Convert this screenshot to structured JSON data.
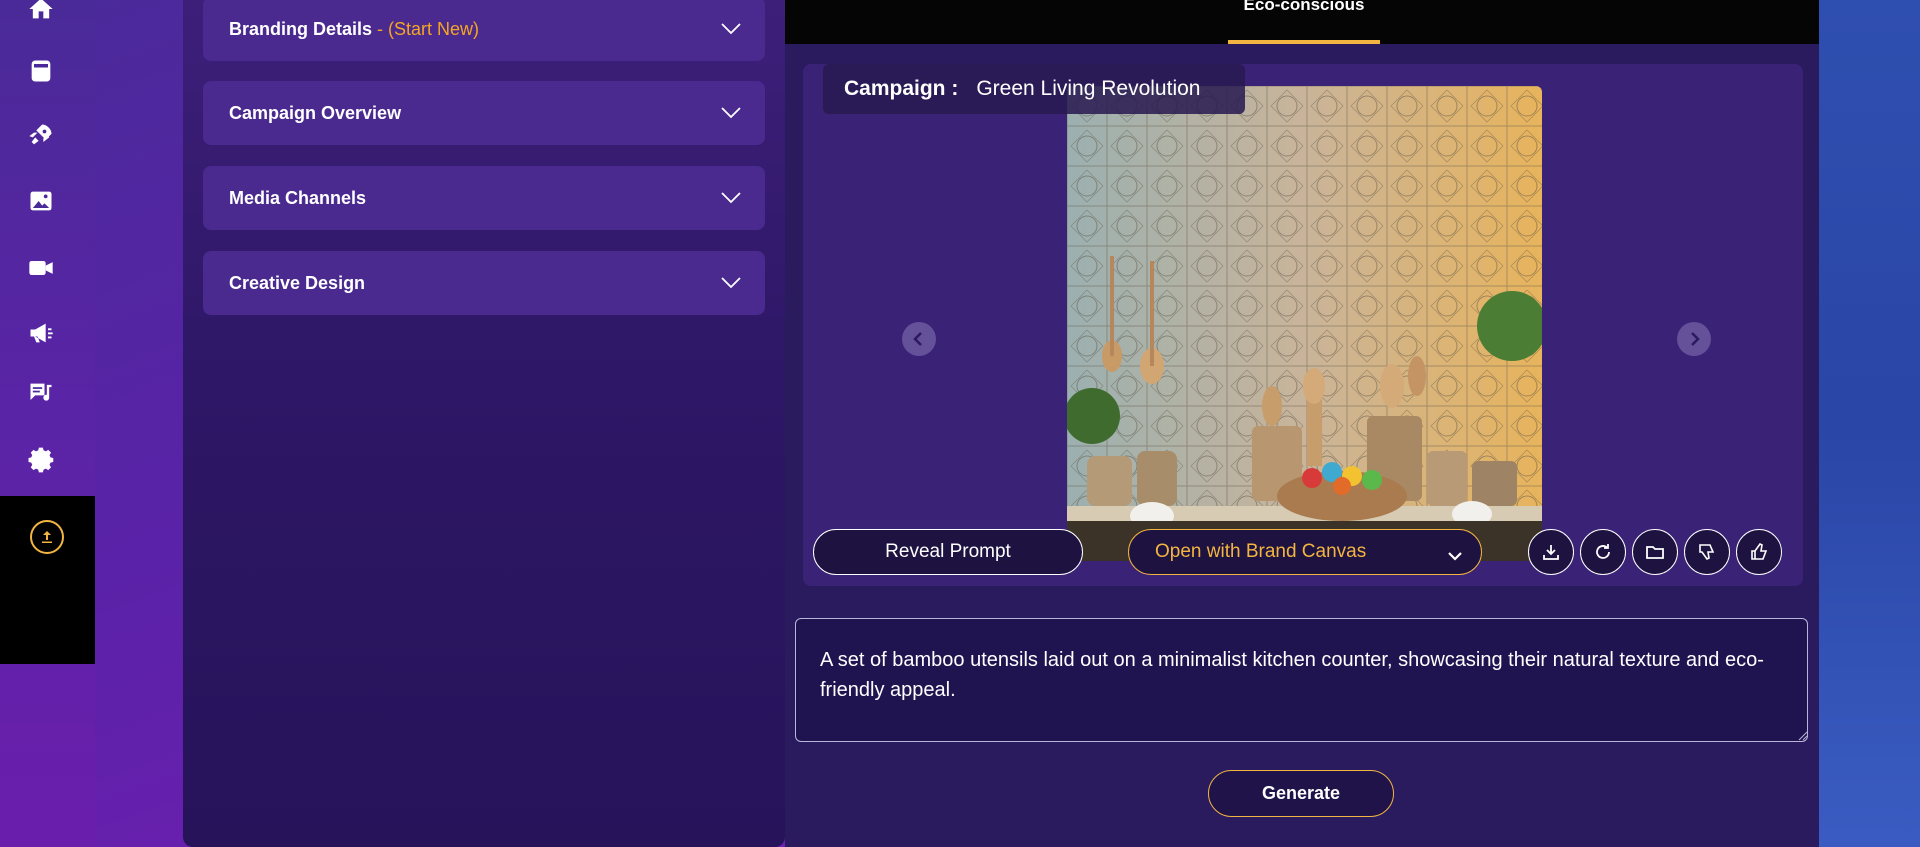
{
  "sidebar": {
    "icons": [
      "home-icon",
      "calendar-icon",
      "rocket-icon",
      "image-icon",
      "video-icon",
      "megaphone-icon",
      "chat-music-icon",
      "gear-icon"
    ],
    "upload_icon": "upload-icon"
  },
  "accordions": [
    {
      "title": "Branding Details",
      "suffix": " - (Start New)"
    },
    {
      "title": "Campaign Overview"
    },
    {
      "title": "Media Channels"
    },
    {
      "title": "Creative Design"
    }
  ],
  "tabs": {
    "active": "Eco-conscious"
  },
  "preview": {
    "campaign_label": "Campaign :",
    "campaign_name": "Green Living Revolution"
  },
  "actions": {
    "reveal_prompt": "Reveal Prompt",
    "open_brand_canvas": "Open with Brand Canvas",
    "icons": [
      "download-icon",
      "refresh-icon",
      "folder-icon",
      "thumbs-down-icon",
      "thumbs-up-icon"
    ]
  },
  "prompt": {
    "value": "A set of bamboo utensils laid out on a minimalist kitchen counter, showcasing their natural texture and eco-friendly appeal."
  },
  "generate_label": "Generate",
  "colors": {
    "accent": "#f2b540",
    "panel": "#2a1a5e",
    "accordion": "#4a2a8e"
  }
}
